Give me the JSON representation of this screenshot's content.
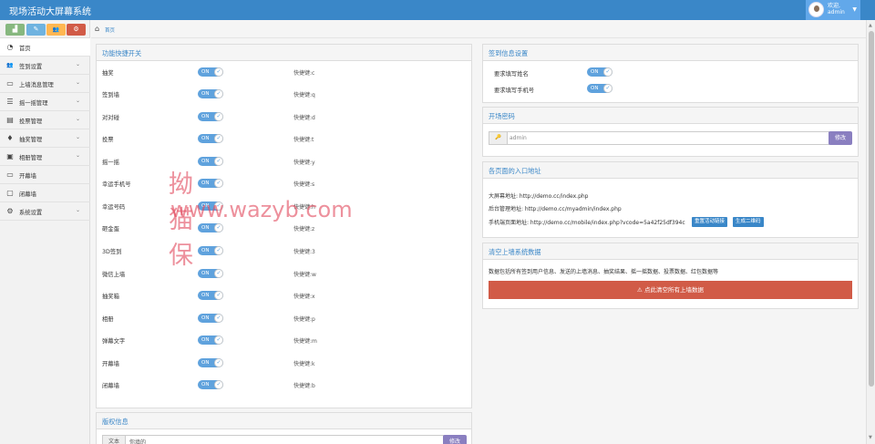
{
  "app": {
    "title": "现场活动大屏幕系统"
  },
  "user": {
    "welcome": "欢迎,",
    "name": "admin",
    "caret": "▼"
  },
  "shortcuts": [
    {
      "icon": "signal-icon",
      "glyph": "▟",
      "color": "#87b87f"
    },
    {
      "icon": "pencil-icon",
      "glyph": "✎",
      "color": "#6fb3e0"
    },
    {
      "icon": "users-icon",
      "glyph": "👥",
      "color": "#ffb752"
    },
    {
      "icon": "cogs-icon",
      "glyph": "⚙",
      "color": "#d15b47"
    }
  ],
  "menu": [
    {
      "label": "首页",
      "icon": "dashboard-icon",
      "glyph": "◔",
      "chevron": ""
    },
    {
      "label": "签到设置",
      "icon": "users-icon",
      "glyph": "👥",
      "chevron": "⌄"
    },
    {
      "label": "上墙消息管理",
      "icon": "desktop-icon",
      "glyph": "▭",
      "chevron": "⌄"
    },
    {
      "label": "摇一摇管理",
      "icon": "list-icon",
      "glyph": "☰",
      "chevron": "⌄"
    },
    {
      "label": "投票管理",
      "icon": "list-alt-icon",
      "glyph": "▤",
      "chevron": "⌄"
    },
    {
      "label": "抽奖管理",
      "icon": "gift-icon",
      "glyph": "♦",
      "chevron": "⌄"
    },
    {
      "label": "相册管理",
      "icon": "picture-icon",
      "glyph": "▣",
      "chevron": "⌄"
    },
    {
      "label": "开幕墙",
      "icon": "desktop-icon",
      "glyph": "▭",
      "chevron": ""
    },
    {
      "label": "闭幕墙",
      "icon": "film-icon",
      "glyph": "▢",
      "chevron": ""
    },
    {
      "label": "系统设置",
      "icon": "gear-icon",
      "glyph": "⚙",
      "chevron": "⌄"
    }
  ],
  "breadcrumb": {
    "home_icon": "⌂",
    "label": "首页"
  },
  "features": {
    "title": "功能快捷开关",
    "toggle_on": "ON",
    "toggle_check": "✓",
    "items": [
      {
        "label": "抽奖",
        "key": "快捷键:c"
      },
      {
        "label": "签到墙",
        "key": "快捷键:q"
      },
      {
        "label": "对对碰",
        "key": "快捷键:d"
      },
      {
        "label": "投票",
        "key": "快捷键:t"
      },
      {
        "label": "摇一摇",
        "key": "快捷键:y"
      },
      {
        "label": "幸运手机号",
        "key": "快捷键:s"
      },
      {
        "label": "幸运号码",
        "key": "快捷键:h"
      },
      {
        "label": "砸金蛋",
        "key": "快捷键:z"
      },
      {
        "label": "3D签到",
        "key": "快捷键:3"
      },
      {
        "label": "微信上墙",
        "key": "快捷键:w"
      },
      {
        "label": "抽奖箱",
        "key": "快捷键:x"
      },
      {
        "label": "相册",
        "key": "快捷键:p"
      },
      {
        "label": "弹幕文字",
        "key": "快捷键:m"
      },
      {
        "label": "开幕墙",
        "key": "快捷键:k"
      },
      {
        "label": "闭幕墙",
        "key": "快捷键:b"
      }
    ]
  },
  "signin": {
    "title": "签到信息设置",
    "items": [
      {
        "label": "要求填写姓名"
      },
      {
        "label": "要求填写手机号"
      }
    ]
  },
  "password": {
    "title": "开场密码",
    "key_icon": "🔑",
    "value": "admin",
    "button": "修改"
  },
  "entry": {
    "title": "各页面的入口地址",
    "lines": [
      "大屏幕地址: http://demo.cc/index.php",
      "后台管理地址: http://demo.cc/myadmin/index.php",
      "手机端页面地址: http://demo.cc/mobile/index.php?vcode=5a42f25df394c"
    ],
    "btn_reset": "重置活动链接",
    "btn_qrcode": "生成二维码"
  },
  "clear": {
    "title": "清空上墙系统数据",
    "description": "数据包括所有签到用户信息、发送的上墙消息、抽奖结果、摇一摇数据、投票数据、红包数据等",
    "warning_icon": "⚠",
    "button": "点此清空所有上墙数据"
  },
  "copyright": {
    "title": "版权信息",
    "addon": "文本",
    "placeholder": "你填的",
    "button": "修改"
  },
  "watermark": {
    "line1": "拗猫保",
    "line2": "www.wazyb.com"
  },
  "scrollbar": {
    "up": "▲",
    "down": "▼"
  }
}
